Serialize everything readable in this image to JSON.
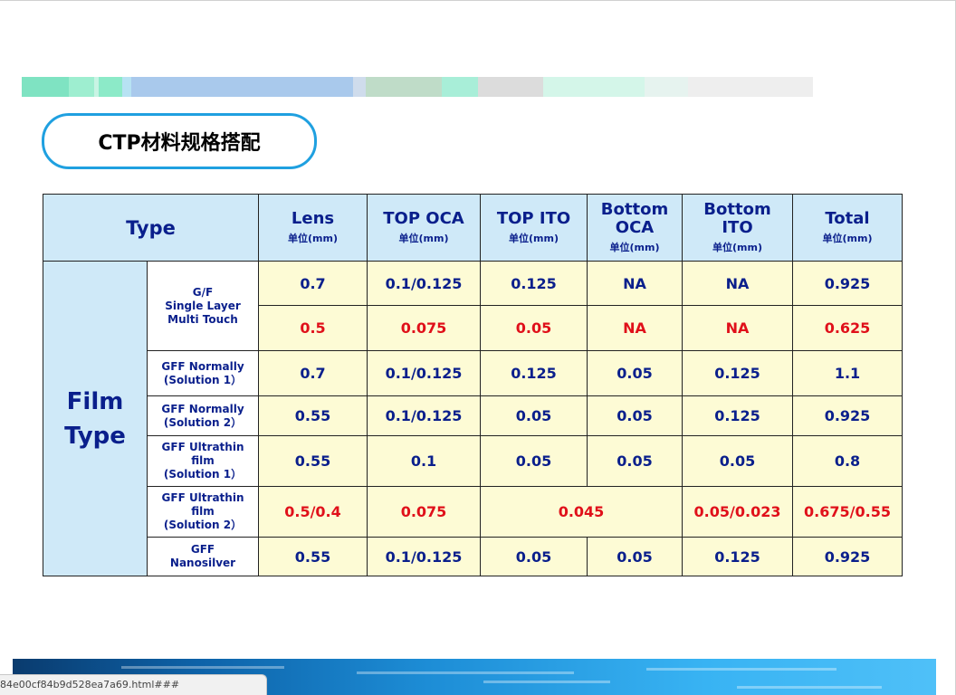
{
  "title": "CTP材料规格搭配",
  "colors": {
    "header_bg": "#cfe9f8",
    "cell_bg": "#fdfbd5",
    "blue_text": "#0a1f8c",
    "red_text": "#e0101a",
    "pill_border": "#1fa0e0"
  },
  "table": {
    "type_header": "Type",
    "film_type": [
      "Film",
      "Type"
    ],
    "unit": "单位(mm)",
    "columns": [
      {
        "lines": [
          "Lens"
        ]
      },
      {
        "lines": [
          "TOP OCA"
        ]
      },
      {
        "lines": [
          "TOP ITO"
        ]
      },
      {
        "lines": [
          "Bottom",
          "OCA"
        ]
      },
      {
        "lines": [
          "Bottom",
          "ITO"
        ]
      },
      {
        "lines": [
          "Total"
        ]
      }
    ],
    "groups": [
      {
        "label": [
          "G/F",
          "Single Layer",
          "Multi Touch"
        ],
        "rows": [
          [
            "0.7",
            "0.1/0.125",
            "0.125",
            "NA",
            "NA",
            "0.925"
          ],
          [
            "0.5",
            "0.075",
            "0.05",
            "NA",
            "NA",
            "0.625"
          ]
        ]
      },
      {
        "label": [
          "GFF Normally",
          "(Solution 1）"
        ],
        "rows": [
          [
            "0.7",
            "0.1/0.125",
            "0.125",
            "0.05",
            "0.125",
            "1.1"
          ]
        ]
      },
      {
        "label": [
          "GFF Normally",
          "(Solution 2）"
        ],
        "rows": [
          [
            "0.55",
            "0.1/0.125",
            "0.05",
            "0.05",
            "0.125",
            "0.925"
          ]
        ]
      },
      {
        "label": [
          "GFF Ultrathin",
          "film",
          "(Solution 1）"
        ],
        "rows": [
          [
            "0.55",
            "0.1",
            "0.05",
            "0.05",
            "0.05",
            "0.8"
          ]
        ]
      },
      {
        "label": [
          "GFF Ultrathin",
          "film",
          "(Solution 2）"
        ],
        "rows": [
          [
            "0.5/0.4",
            "0.075",
            "0.045",
            "0.05/0.023",
            "0.675/0.55"
          ]
        ]
      },
      {
        "label": [
          "GFF",
          "Nanosilver"
        ],
        "rows": [
          [
            "0.55",
            "0.1/0.125",
            "0.05",
            "0.05",
            "0.125",
            "0.925"
          ]
        ]
      }
    ]
  },
  "status_url": "84e00cf84b9d528ea7a69.html###"
}
